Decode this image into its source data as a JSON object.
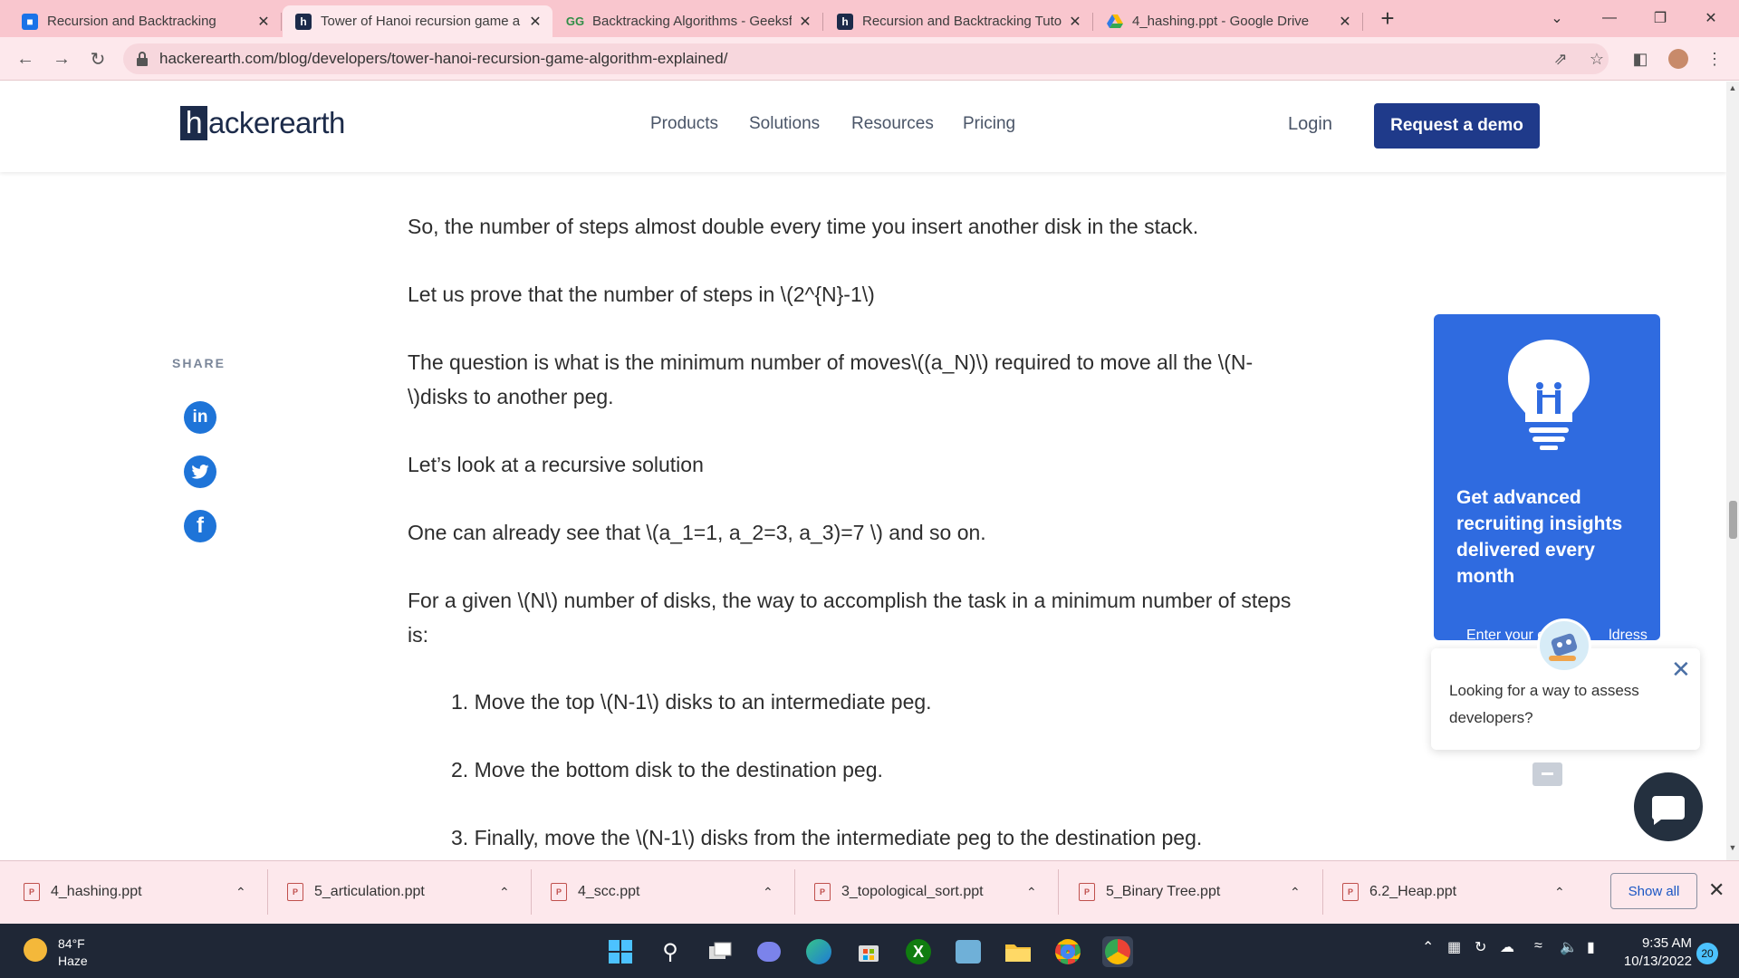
{
  "tabs": [
    {
      "title": "Recursion and Backtracking",
      "favicon": "contacts-icon"
    },
    {
      "title": "Tower of Hanoi recursion game a",
      "favicon": "hackerearth-icon"
    },
    {
      "title": "Backtracking Algorithms - Geeksf",
      "favicon": "geeksforgeeks-icon"
    },
    {
      "title": "Recursion and Backtracking Tuto",
      "favicon": "hackerearth-icon"
    },
    {
      "title": "4_hashing.ppt - Google Drive",
      "favicon": "google-drive-icon"
    }
  ],
  "address": {
    "url": "hackerearth.com/blog/developers/tower-hanoi-recursion-game-algorithm-explained/"
  },
  "site": {
    "logo_h": "h",
    "logo_rest": "ackerearth",
    "nav": [
      "Products",
      "Solutions",
      "Resources",
      "Pricing"
    ],
    "login": "Login",
    "demo": "Request a demo"
  },
  "article": {
    "paragraphs": [
      "So, the number of steps almost double every time you insert another disk in the stack.",
      "Let us prove that the number of steps in \\(2^{N}-1\\)",
      "The question is what is the minimum number of moves\\((a_N)\\) required to move all the \\(N-\\)disks to another peg.",
      "Let’s look at a recursive solution",
      "One can already see that \\(a_1=1, a_2=3, a_3)=7 \\) and so on.",
      "For a given \\(N\\) number of disks, the way to accomplish the task in a minimum number of steps is:"
    ],
    "steps": [
      "1. Move the top \\(N-1\\) disks to an intermediate peg.",
      "2. Move the bottom disk to the destination peg.",
      "3. Finally, move the \\(N-1\\) disks from the intermediate peg to the destination peg."
    ]
  },
  "share": {
    "label": "SHARE",
    "icons": [
      "linkedin-icon",
      "twitter-icon",
      "facebook-icon"
    ]
  },
  "card": {
    "title": "Get advanced recruiting insights delivered every month",
    "input_text_left": "Enter your e",
    "input_text_right": "ldress"
  },
  "popup": {
    "text": "Looking for a way to assess developers?"
  },
  "downloads": {
    "files": [
      "4_hashing.ppt",
      "5_articulation.ppt",
      "4_scc.ppt",
      "3_topological_sort.ppt",
      "5_Binary Tree.ppt",
      "6.2_Heap.ppt"
    ],
    "show_all": "Show all"
  },
  "taskbar": {
    "temp": "84°F",
    "condition": "Haze",
    "time": "9:35 AM",
    "date": "10/13/2022",
    "notifications": "20"
  },
  "colors": {
    "brand": "#1f3a8a",
    "card": "#2f6be0",
    "tabstrip": "#f9c6ce"
  }
}
